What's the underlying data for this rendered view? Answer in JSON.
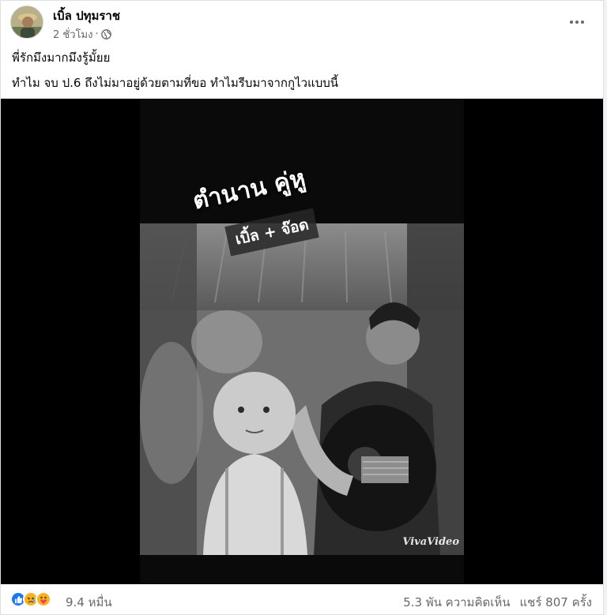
{
  "post": {
    "author": "เบิ้ล ปทุมราช",
    "timestamp": "2 ชั่วโมง",
    "separator": "·",
    "audience_icon": "globe-icon",
    "more_icon": "ellipsis-icon",
    "text_line_1": "พี่รักมึงมากมึงรู้มั้ยย",
    "text_line_2": "ทำไม จบ ป.6 ถึงไม่มาอยู่ด้วยตามที่ขอ   ทำไมรีบมาจากกูไวแบบนี้"
  },
  "video": {
    "title_overlay": "ตำนาน คู่หู",
    "subtitle_overlay": "เบิ้ล + จ๊อด",
    "watermark": "VivaVideo"
  },
  "footer": {
    "reaction_icons": [
      "like-icon",
      "sad-icon",
      "care-icon"
    ],
    "reaction_count": "9.4 หมื่น",
    "comments": "5.3 พัน ความคิดเห็น",
    "shares": "แชร์ 807 ครั้ง"
  },
  "colors": {
    "like": "#1877f2",
    "reaction_emoji": "#f7b125",
    "secondary_text": "#65676b"
  }
}
